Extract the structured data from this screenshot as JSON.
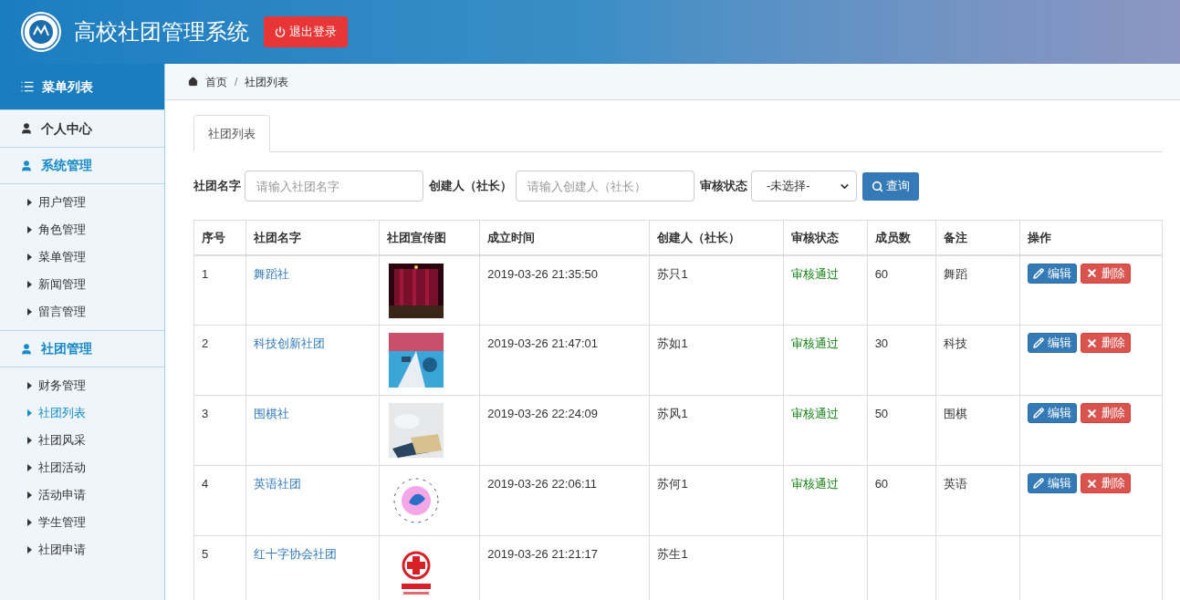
{
  "header": {
    "title": "高校社团管理系统",
    "logout_button": "退出登录"
  },
  "sidebar": {
    "title": "菜单列表",
    "sections": [
      {
        "label": "个人中心",
        "kind": "link"
      },
      {
        "label": "系统管理",
        "kind": "group",
        "children": [
          {
            "label": "用户管理",
            "selected": false
          },
          {
            "label": "角色管理",
            "selected": false
          },
          {
            "label": "菜单管理",
            "selected": false
          },
          {
            "label": "新闻管理",
            "selected": false
          },
          {
            "label": "留言管理",
            "selected": false
          }
        ]
      },
      {
        "label": "社团管理",
        "kind": "group",
        "children": [
          {
            "label": "财务管理",
            "selected": false
          },
          {
            "label": "社团列表",
            "selected": true
          },
          {
            "label": "社团风采",
            "selected": false
          },
          {
            "label": "社团活动",
            "selected": false
          },
          {
            "label": "活动申请",
            "selected": false
          },
          {
            "label": "学生管理",
            "selected": false
          },
          {
            "label": "社团申请",
            "selected": false
          }
        ]
      }
    ]
  },
  "breadcrumb": {
    "separator": "/",
    "items": [
      "首页",
      "社团列表"
    ]
  },
  "tabs": [
    {
      "label": "社团列表",
      "selected": true
    }
  ],
  "search": {
    "fields": [
      {
        "label": "社团名字",
        "placeholder": "请输入社团名字"
      },
      {
        "label": "创建人（社长）",
        "placeholder": "请输入创建人（社长）"
      }
    ],
    "status_label": "审核状态",
    "status_value": "-未选择-",
    "query_button": "查询"
  },
  "table": {
    "columns": [
      "序号",
      "社团名字",
      "社团宣传图",
      "成立时间",
      "创建人（社长）",
      "审核状态",
      "成员数",
      "备注",
      "操作"
    ],
    "rows": [
      {
        "no": "1",
        "name": "舞蹈社",
        "picture": {
          "kind": "picture"
        },
        "founded": "2019-03-26 21:35:50",
        "creator": "苏只1",
        "status": {
          "text": "审核通过",
          "kind": "approved"
        },
        "members": "60",
        "note": "舞蹈",
        "actions": [
          "编辑",
          "删除"
        ]
      },
      {
        "no": "2",
        "name": "科技创新社团",
        "picture": {
          "kind": "picture"
        },
        "founded": "2019-03-26 21:47:01",
        "creator": "苏如1",
        "status": {
          "text": "审核通过",
          "kind": "approved"
        },
        "members": "30",
        "note": "科技",
        "actions": [
          "编辑",
          "删除"
        ]
      },
      {
        "no": "3",
        "name": "围棋社",
        "picture": {
          "kind": "picture"
        },
        "founded": "2019-03-26 22:24:09",
        "creator": "苏风1",
        "status": {
          "text": "审核通过",
          "kind": "approved"
        },
        "members": "50",
        "note": "围棋",
        "actions": [
          "编辑",
          "删除"
        ]
      },
      {
        "no": "4",
        "name": "英语社团",
        "picture": {
          "kind": "picture"
        },
        "founded": "2019-03-26 22:06:11",
        "creator": "苏何1",
        "status": {
          "text": "审核通过",
          "kind": "approved"
        },
        "members": "60",
        "note": "英语",
        "actions": [
          "编辑",
          "删除"
        ]
      },
      {
        "no": "5",
        "name": "红十字协会社团",
        "picture": {
          "kind": "picture"
        },
        "founded": "2019-03-26 21:21:17",
        "creator": "苏生1"
      }
    ]
  }
}
